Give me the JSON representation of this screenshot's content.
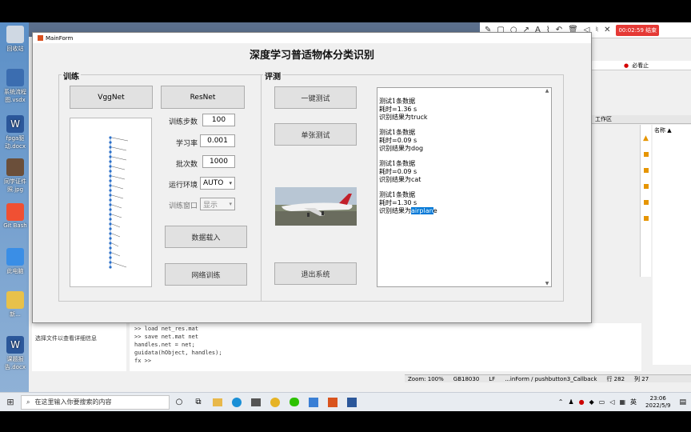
{
  "annotation_toolbar": {
    "timer": "00:02:59 结束"
  },
  "desktop_icons": [
    {
      "label": "回收站"
    },
    {
      "label": "系统流程图.vsdx"
    },
    {
      "label": "fpga驱动.docx"
    },
    {
      "label": "同学证件照.jpg"
    },
    {
      "label": "Git Bash"
    },
    {
      "label": "此电脑"
    },
    {
      "label": "新..."
    },
    {
      "label": "课题报告.docx"
    }
  ],
  "matlab": {
    "workspace_title": "工作区",
    "workspace_col": "名称 ▲",
    "console_lines": [
      ">> load net_res.mat",
      ">> save net.mat net",
      "handles.net = net;",
      "guidata(hObject, handles);"
    ],
    "prompt": "fx >>",
    "left_hint": "选择文件以查看详细信息",
    "status": {
      "zoom": "Zoom: 100%",
      "encoding": "GB18030",
      "lf": "LF",
      "path": "...inForm / pushbutton3_Callback",
      "row": "行 282",
      "col": "列 27"
    },
    "user_label": "必看止"
  },
  "window": {
    "title": "MainForm",
    "heading": "深度学习普适物体分类识别"
  },
  "train": {
    "title": "训练",
    "vgg_btn": "VggNet",
    "res_btn": "ResNet",
    "steps_label": "训练步数",
    "steps_value": "100",
    "lr_label": "学习率",
    "lr_value": "0.001",
    "batch_label": "批次数",
    "batch_value": "1000",
    "env_label": "运行环境",
    "env_value": "AUTO",
    "window_label": "训练窗口",
    "window_value": "显示",
    "load_btn": "数据载入",
    "train_btn": "网络训练"
  },
  "eval": {
    "title": "评测",
    "one_click_btn": "一键测试",
    "single_btn": "单张测试",
    "exit_btn": "退出系统"
  },
  "results": [
    {
      "line1": "测试1条数据",
      "line2_cn": "耗时=",
      "line2_val": "1.36 s",
      "line3_cn": "识别结果为",
      "line3_val": "truck"
    },
    {
      "line1": "测试1条数据",
      "line2_cn": "耗时=",
      "line2_val": "0.09 s",
      "line3_cn": "识别结果为",
      "line3_val": "dog"
    },
    {
      "line1": "测试1条数据",
      "line2_cn": "耗时=",
      "line2_val": "0.09 s",
      "line3_cn": "识别结果为",
      "line3_val": "cat"
    },
    {
      "line1": "测试1条数据",
      "line2_cn": "耗时=",
      "line2_val": "1.30 s",
      "line3_cn": "识别结果为",
      "line3_val_sel": "airplan",
      "line3_val_rest": "e"
    }
  ],
  "taskbar": {
    "search_placeholder": "在这里输入你要搜索的内容",
    "ime": "英",
    "time": "23:06",
    "date": "2022/5/9"
  }
}
